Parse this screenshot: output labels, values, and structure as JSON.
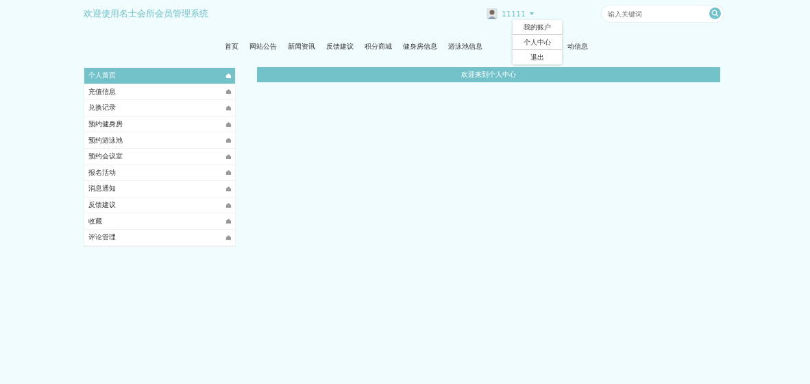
{
  "site_title": "欢迎使用名士会所会员管理系统",
  "user": {
    "name": "11111"
  },
  "user_menu": [
    "我的账户",
    "个人中心",
    "退出"
  ],
  "search": {
    "placeholder": "输入关键词"
  },
  "nav": [
    "首页",
    "网站公告",
    "新闻资讯",
    "反馈建议",
    "积分商城",
    "健身房信息",
    "游泳池信息"
  ],
  "nav_after_menu": [
    "动信息"
  ],
  "sidebar": {
    "items": [
      {
        "label": "个人首页",
        "selected": true
      },
      {
        "label": "充值信息",
        "selected": false
      },
      {
        "label": "兑换记录",
        "selected": false
      },
      {
        "label": "预约健身房",
        "selected": false
      },
      {
        "label": "预约游泳池",
        "selected": false
      },
      {
        "label": "预约会议室",
        "selected": false
      },
      {
        "label": "报名活动",
        "selected": false
      },
      {
        "label": "消息通知",
        "selected": false
      },
      {
        "label": "反馈建议",
        "selected": false
      },
      {
        "label": "收藏",
        "selected": false
      },
      {
        "label": "评论管理",
        "selected": false
      }
    ]
  },
  "main": {
    "heading": "欢迎来到个人中心"
  }
}
